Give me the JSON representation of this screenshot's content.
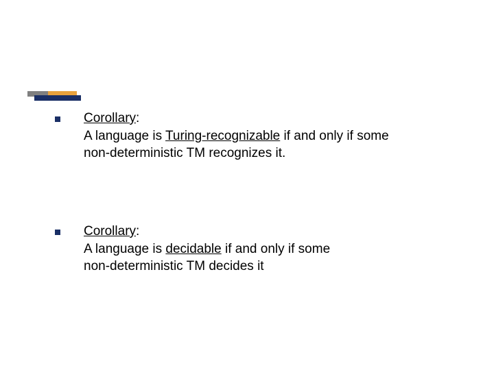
{
  "bullets": [
    {
      "label": "Corollary",
      "line1_prefix": "A language is ",
      "line1_term": "Turing-recognizable",
      "line1_suffix": " if and only if some",
      "line2": "non-deterministic TM recognizes it."
    },
    {
      "label": "Corollary",
      "line1_prefix": "A language is ",
      "line1_term": "decidable",
      "line1_suffix": " if and only if some",
      "line2": "non-deterministic TM decides it"
    }
  ]
}
